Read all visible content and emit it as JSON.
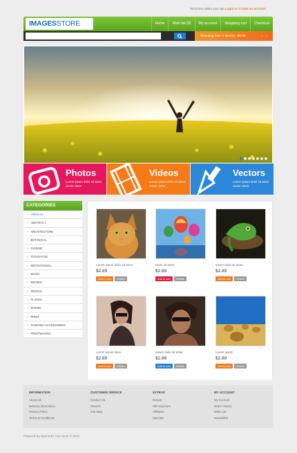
{
  "top": {
    "welcome": "Welcome visitor you can",
    "login": "Login",
    "or": "or",
    "create": "Create an account"
  },
  "logo": {
    "part1": "IMAGES",
    "part2": "STORE"
  },
  "nav": [
    "Home",
    "Wish list (0)",
    "My account",
    "Shopping cart",
    "Checkout"
  ],
  "search": {
    "placeholder": ""
  },
  "cart": {
    "label": "Shopping Cart:",
    "value": "0 item(s) - $0.00",
    "arrows": "‹ ›"
  },
  "promos": [
    {
      "title": "Photos",
      "text": "Lorem ipsum dolor sit amet conse ctetur"
    },
    {
      "title": "Videos",
      "text": "Lorem ipsum dolor sit amet conse ctetur"
    },
    {
      "title": "Vectors",
      "text": "Lorem ipsum dolor sit amet conse ctetur"
    }
  ],
  "categories": {
    "title": "CATEGORIES",
    "items": [
      "Animals",
      "Abstract",
      "Architecture",
      "Botanical",
      "Cuisine",
      "Figurative",
      "Motivational",
      "Music",
      "Movies",
      "People",
      "Places",
      "Scenic",
      "Print",
      "Painting accessories",
      "Printmaking"
    ]
  },
  "products": [
    {
      "name": "Lorem ipsum dolor sit amet",
      "price": "$2.89",
      "add": "Add to cart",
      "details": "Details",
      "icon": "cat-photo"
    },
    {
      "name": "Dolor sit amet",
      "price": "$2.89",
      "add": "Add to cart",
      "details": "Details",
      "icon": "balloons-photo"
    },
    {
      "name": "Ipsum dolor sit amet",
      "price": "$2.89",
      "add": "Add to cart",
      "details": "Details",
      "icon": "lizard-photo"
    },
    {
      "name": "Lorem ipsum dolor",
      "price": "$2.89",
      "add": "Add to cart",
      "details": "Details",
      "icon": "woman-photo"
    },
    {
      "name": "Ipsum dolor sit amet",
      "price": "$2.89",
      "add": "Add to cart",
      "details": "Details",
      "icon": "man-photo"
    },
    {
      "name": "Lorem ipsum",
      "price": "$2.89",
      "add": "Add to cart",
      "details": "Details",
      "icon": "hay-field-photo"
    }
  ],
  "colors": {
    "add_buttons": [
      "#f07a1c",
      "#d8213b",
      "#f07a1c",
      "#f07a1c",
      "#2a80d1",
      "#f07a1c"
    ],
    "accent_green": "#5aa61f",
    "accent_blue": "#1d7dd4"
  },
  "footer": {
    "columns": [
      {
        "title": "INFORMATION",
        "links": [
          "About Us",
          "Delivery Information",
          "Privacy Policy",
          "Terms & Conditions"
        ]
      },
      {
        "title": "CUSTOMER SERVICE",
        "links": [
          "Contact Us",
          "Returns",
          "Site Map"
        ]
      },
      {
        "title": "EXTRAS",
        "links": [
          "Brands",
          "Gift Vouchers",
          "Affiliates",
          "Specials"
        ]
      },
      {
        "title": "MY ACCOUNT",
        "links": [
          "My Account",
          "Order History",
          "Wish List",
          "Newsletter"
        ]
      }
    ],
    "powered": "Powered By OpenCart Your Store © 2012"
  },
  "slider": {
    "slides": 7,
    "active": 1
  }
}
